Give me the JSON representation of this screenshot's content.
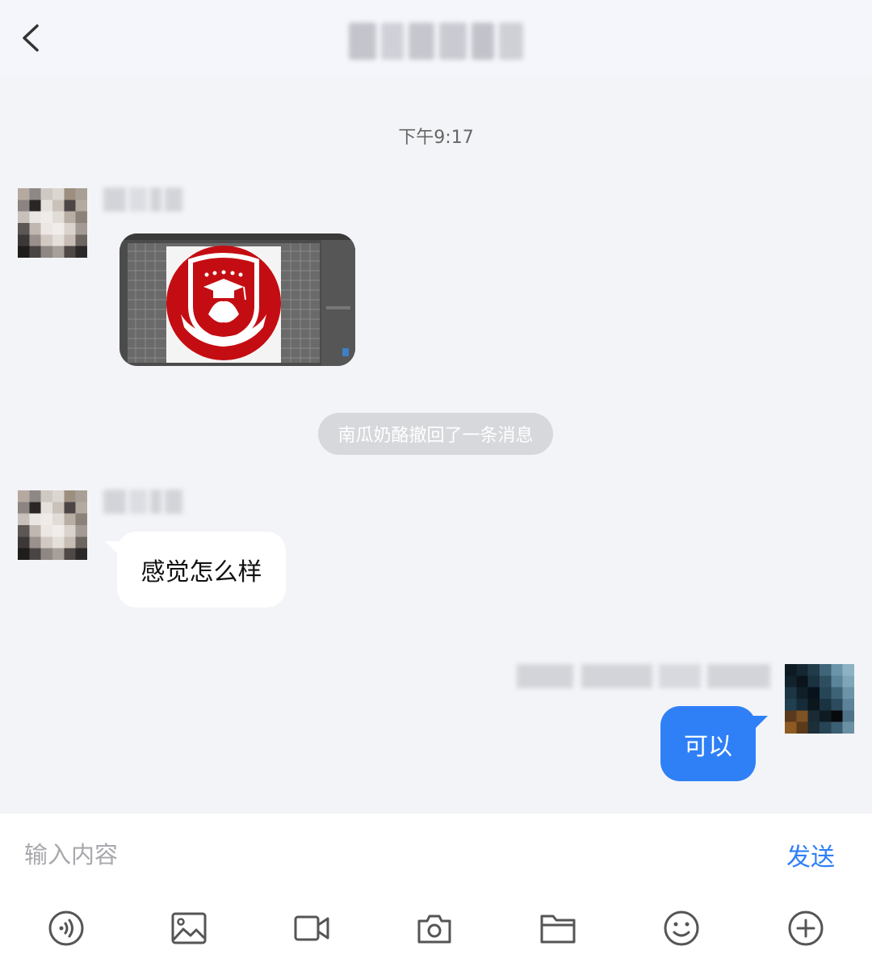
{
  "header": {
    "back_icon": "chevron-left-icon"
  },
  "messages": {
    "time": "下午9:17",
    "recall_notice": "南瓜奶酪撤回了一条消息",
    "incoming_text": "感觉怎么样",
    "outgoing_text": "可以"
  },
  "composer": {
    "placeholder": "输入内容",
    "send_label": "发送"
  },
  "toolbar": {
    "icons": [
      "voice-icon",
      "image-icon",
      "video-icon",
      "camera-icon",
      "folder-icon",
      "emoji-icon",
      "plus-icon"
    ]
  },
  "colors": {
    "accent": "#2f80f7",
    "background": "#f3f4f7",
    "header_background": "#f5f6fb",
    "badge_red": "#c40d12"
  }
}
